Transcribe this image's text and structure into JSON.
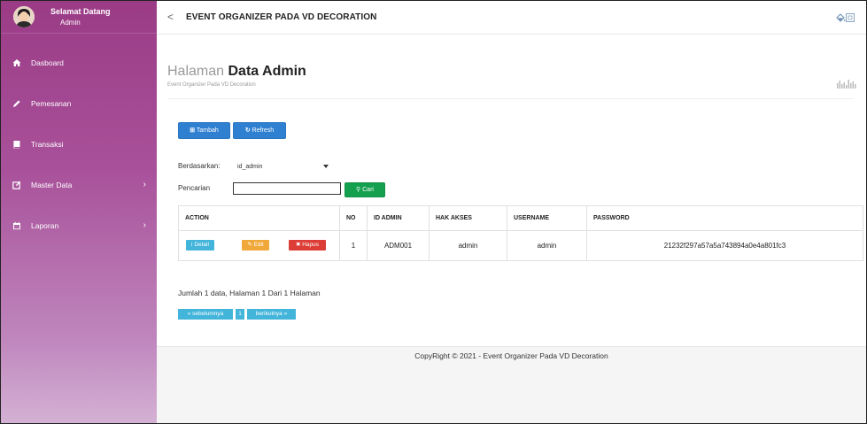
{
  "user": {
    "greeting": "Selamat Datang",
    "name": "Admin"
  },
  "sidebar": {
    "items": [
      {
        "label": "Dasboard",
        "icon": "home-icon",
        "has_chevron": false
      },
      {
        "label": "Pemesanan",
        "icon": "pencil-icon",
        "has_chevron": false
      },
      {
        "label": "Transaksi",
        "icon": "book-icon",
        "has_chevron": false
      },
      {
        "label": "Master Data",
        "icon": "edit-box-icon",
        "has_chevron": true
      },
      {
        "label": "Laporan",
        "icon": "calendar-icon",
        "has_chevron": true
      }
    ]
  },
  "topbar": {
    "back": "<",
    "title": "EVENT ORGANIZER PADA VD DECORATION"
  },
  "page": {
    "title_light": "Halaman",
    "title_bold": "Data Admin",
    "subtitle": "Event Organizer Pada VD Decoration"
  },
  "toolbar": {
    "add": "Tambah",
    "refresh": "Refresh"
  },
  "filter": {
    "by_label": "Berdasarkan:",
    "by_value": "id_admin",
    "search_label": "Pencarian",
    "search_value": "",
    "search_button": "Cari"
  },
  "table": {
    "columns": [
      "ACTION",
      "NO",
      "ID ADMIN",
      "HAK AKSES",
      "USERNAME",
      "PASSWORD"
    ],
    "rows": [
      {
        "actions": {
          "detail": "Detail",
          "edit": "Edit",
          "delete": "Hapus"
        },
        "no": "1",
        "id_admin": "ADM001",
        "hak_akses": "admin",
        "username": "admin",
        "password": "21232f297a57a5a743894a0e4a801fc3"
      }
    ]
  },
  "summary": "Jumlah 1 data, Halaman 1 Dari 1 Halaman",
  "pagination": {
    "prev": "« sebelumnya",
    "page": "1",
    "next": "berikutnya »"
  },
  "footer": "CopyRight © 2021 - Event Organizer Pada VD Decoration",
  "colors": {
    "sidebar_top": "#9b3b86",
    "sidebar_bottom": "#d4b1d4",
    "primary": "#2f80d1",
    "success": "#15a04f",
    "info": "#44b5da",
    "warning": "#f1a83a",
    "danger": "#dc3d36"
  }
}
